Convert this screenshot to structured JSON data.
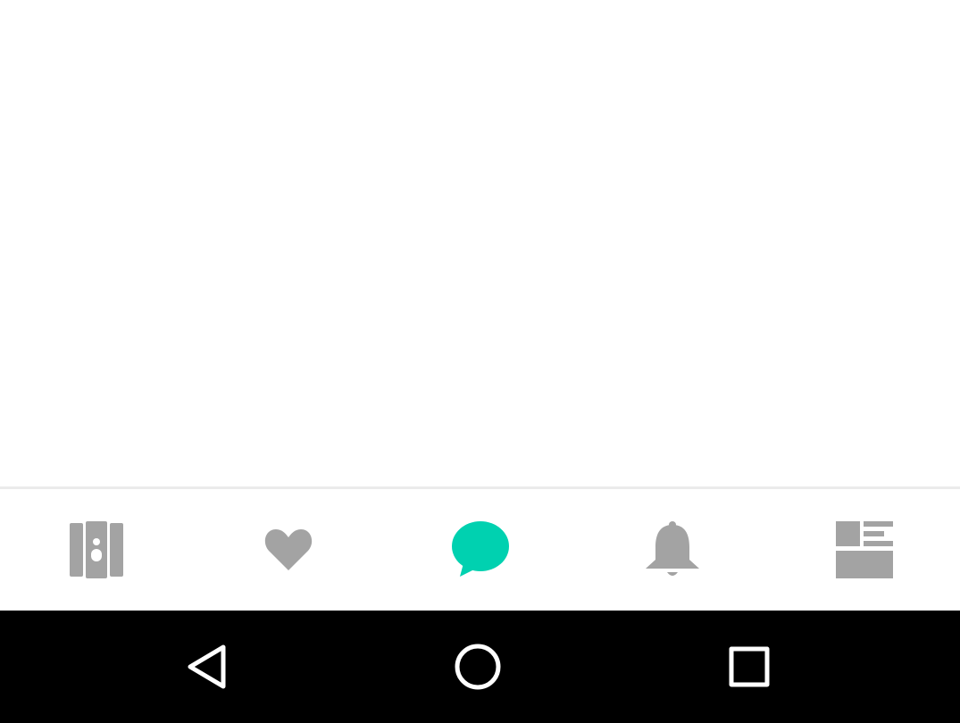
{
  "colors": {
    "active": "#00d1b0",
    "inactive": "#a3a3a3",
    "nav_bar": "#000000",
    "nav_icon": "#ffffff"
  },
  "tab_bar": {
    "active_tab": "messages",
    "tabs": [
      {
        "id": "browse",
        "icon": "people-book-icon"
      },
      {
        "id": "likes",
        "icon": "heart-icon"
      },
      {
        "id": "messages",
        "icon": "chat-bubble-icon"
      },
      {
        "id": "notifications",
        "icon": "bell-icon"
      },
      {
        "id": "feed",
        "icon": "dashboard-icon"
      }
    ]
  },
  "system_nav": {
    "buttons": [
      {
        "id": "back",
        "icon": "back-triangle-icon"
      },
      {
        "id": "home",
        "icon": "home-circle-icon"
      },
      {
        "id": "recents",
        "icon": "recents-square-icon"
      }
    ]
  }
}
